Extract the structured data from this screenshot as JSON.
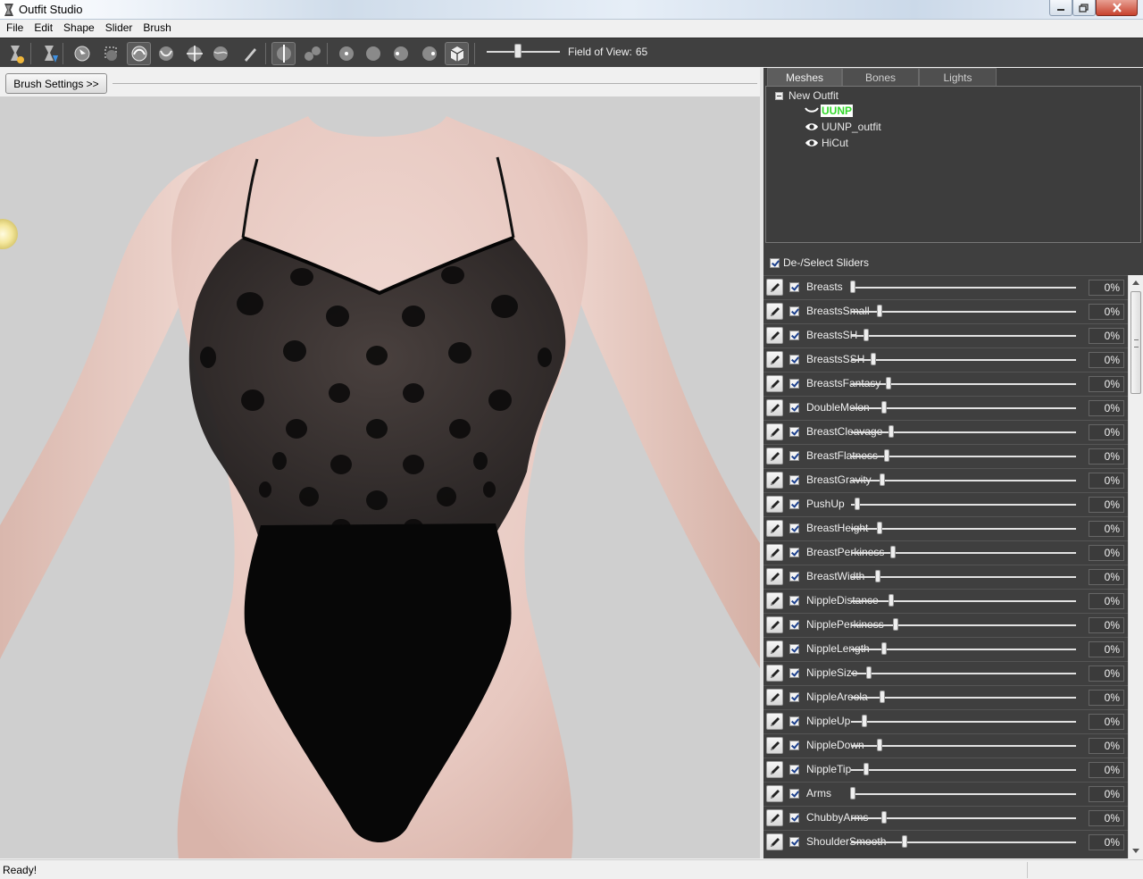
{
  "window": {
    "title": "Outfit Studio"
  },
  "menu": [
    "File",
    "Edit",
    "Shape",
    "Slider",
    "Brush"
  ],
  "toolbar": {
    "tools": [
      {
        "icon": "load-reference-icon"
      },
      {
        "icon": "load-outfit-icon"
      },
      {
        "icon": "select-brush-icon"
      },
      {
        "icon": "mask-brush-icon"
      },
      {
        "icon": "inflate-brush-icon",
        "active": true
      },
      {
        "icon": "deflate-brush-icon"
      },
      {
        "icon": "move-brush-icon"
      },
      {
        "icon": "smooth-brush-icon"
      },
      {
        "icon": "weight-paint-icon"
      },
      {
        "icon": "x-mirror-icon",
        "active": true
      },
      {
        "icon": "connected-only-icon"
      },
      {
        "icon": "front-view-icon"
      },
      {
        "icon": "back-view-icon"
      },
      {
        "icon": "left-view-icon"
      },
      {
        "icon": "right-view-icon"
      },
      {
        "icon": "perspective-view-icon",
        "active": true
      }
    ],
    "fov_label": "Field of View:",
    "fov_value": "65",
    "fov_fraction": 0.42
  },
  "brush_settings_label": "Brush Settings >>",
  "tabs": [
    {
      "label": "Meshes",
      "active": true
    },
    {
      "label": "Bones"
    },
    {
      "label": "Lights"
    }
  ],
  "mesh_tree": {
    "root": "New Outfit",
    "items": [
      {
        "label": "UUNP",
        "selected": true,
        "visible": false
      },
      {
        "label": "UUNP_outfit",
        "selected": false,
        "visible": true
      },
      {
        "label": "HiCut",
        "selected": false,
        "visible": true
      }
    ]
  },
  "sliders_header": "De-/Select Sliders",
  "sliders": [
    {
      "name": "Breasts",
      "value": "0%",
      "pos": 0.0
    },
    {
      "name": "BreastsSmall",
      "value": "0%",
      "pos": 0.12
    },
    {
      "name": "BreastsSH",
      "value": "0%",
      "pos": 0.06
    },
    {
      "name": "BreastsSSH",
      "value": "0%",
      "pos": 0.09
    },
    {
      "name": "BreastsFantasy",
      "value": "0%",
      "pos": 0.16
    },
    {
      "name": "DoubleMelon",
      "value": "0%",
      "pos": 0.14
    },
    {
      "name": "BreastCleavage",
      "value": "0%",
      "pos": 0.17
    },
    {
      "name": "BreastFlatness",
      "value": "0%",
      "pos": 0.15
    },
    {
      "name": "BreastGravity",
      "value": "0%",
      "pos": 0.13
    },
    {
      "name": "PushUp",
      "value": "0%",
      "pos": 0.02
    },
    {
      "name": "BreastHeight",
      "value": "0%",
      "pos": 0.12
    },
    {
      "name": "BreastPerkiness",
      "value": "0%",
      "pos": 0.18
    },
    {
      "name": "BreastWidth",
      "value": "0%",
      "pos": 0.11
    },
    {
      "name": "NippleDistance",
      "value": "0%",
      "pos": 0.17
    },
    {
      "name": "NipplePerkiness",
      "value": "0%",
      "pos": 0.19
    },
    {
      "name": "NippleLength",
      "value": "0%",
      "pos": 0.14
    },
    {
      "name": "NippleSize",
      "value": "0%",
      "pos": 0.07
    },
    {
      "name": "NippleAreola",
      "value": "0%",
      "pos": 0.13
    },
    {
      "name": "NippleUp",
      "value": "0%",
      "pos": 0.05
    },
    {
      "name": "NippleDown",
      "value": "0%",
      "pos": 0.12
    },
    {
      "name": "NippleTip",
      "value": "0%",
      "pos": 0.06
    },
    {
      "name": "Arms",
      "value": "0%",
      "pos": 0.0
    },
    {
      "name": "ChubbyArms",
      "value": "0%",
      "pos": 0.14
    },
    {
      "name": "ShoulderSmooth",
      "value": "0%",
      "pos": 0.23
    }
  ],
  "status": "Ready!"
}
